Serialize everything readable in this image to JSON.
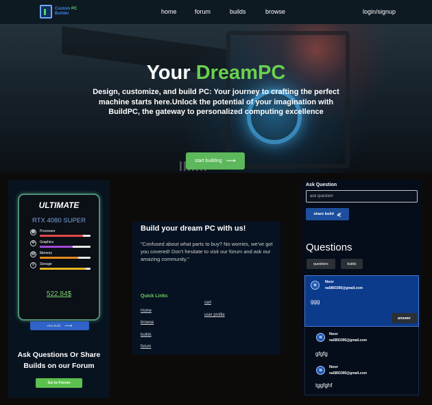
{
  "nav": {
    "logo_line1_a": "Custom",
    "logo_line1_b": "PC",
    "logo_line2": "Builder",
    "links": [
      "home",
      "forum",
      "builds",
      "browse"
    ],
    "auth": "login/signup"
  },
  "hero": {
    "title_plain": "Your ",
    "title_accent": "DreamPC",
    "subtitle": "Design, customize, and build PC: Your journey to crafting the perfect machine starts here.Unlock the potential of your imagination with BuildPC, the gateway to personalized computing excellence",
    "cta": "start building",
    "cta_icon": "arrow-right-icon",
    "accent_color": "#6ad04e"
  },
  "build_card": {
    "title": "ULTIMATE",
    "gpu": "RTX 4080 SUPER",
    "specs": [
      {
        "label": "Processor",
        "icon": "cpu-icon",
        "level": 0.85,
        "color": "#e34a4a"
      },
      {
        "label": "Graphics",
        "icon": "gpu-icon",
        "level": 0.65,
        "color": "#a24ad8"
      },
      {
        "label": "Memory",
        "icon": "memory-icon",
        "level": 0.75,
        "color": "#e6891f"
      },
      {
        "label": "Storage",
        "icon": "storage-icon",
        "level": 0.9,
        "color": "#e6b81f"
      }
    ],
    "price": "522.84$",
    "button": "view build",
    "border_color": "#4f8f74"
  },
  "forum_promo": {
    "heading": "Ask Questions Or Share Builds on our Forum",
    "button": "Go to Forum"
  },
  "about": {
    "title": "Build your dream PC with us!",
    "quote": "\"Confused about what parts to buy? No worries, we've got you covered! Don't hesitate to visit our forum and ask our amazing community.\"",
    "quick_links_title": "Quick Links",
    "links_col1": [
      "Home",
      "browse",
      "builds",
      "forum"
    ],
    "links_col2": [
      "cart",
      "user profile"
    ]
  },
  "questions": {
    "ask_label": "Ask Question",
    "input_placeholder": "ask question",
    "share_button": "share build",
    "heading": "Questions",
    "tabs": [
      "questions",
      "builds"
    ],
    "active_tab": "builds",
    "posts": [
      {
        "initial": "N",
        "name": "Noor",
        "email": "na5893395@gmail.com",
        "body": "ggg",
        "action": "answer",
        "highlighted": true
      },
      {
        "initial": "N",
        "name": "Noor",
        "email": "na5893395@gmail.com",
        "body": "gfgfg",
        "highlighted": false
      },
      {
        "initial": "N",
        "name": "Noor",
        "email": "na5893395@gmail.com",
        "body": "tggfghf",
        "highlighted": false
      }
    ]
  }
}
